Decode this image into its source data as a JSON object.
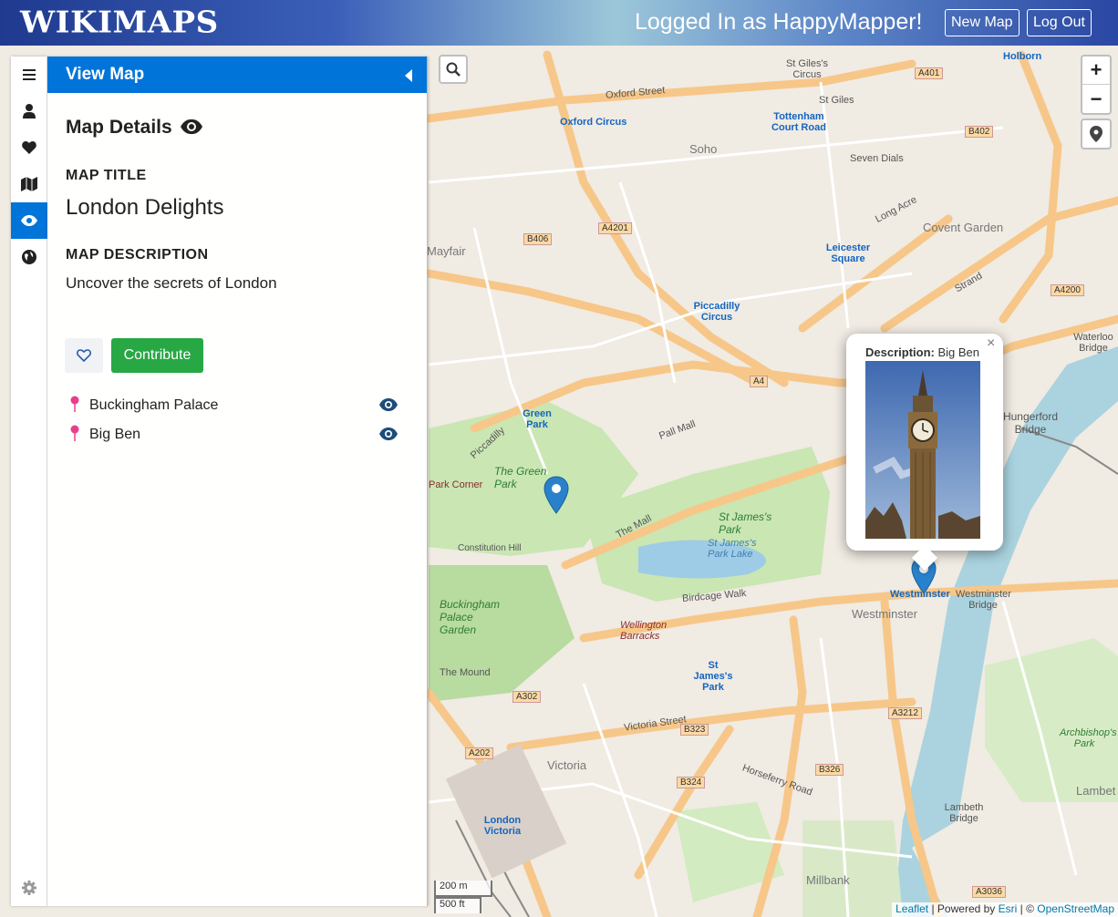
{
  "header": {
    "logo": "WikiMaps",
    "logged_in": "Logged In as HappyMapper!",
    "new_map": "New Map",
    "log_out": "Log Out"
  },
  "rail": {
    "items": [
      {
        "icon": "bars-icon"
      },
      {
        "icon": "user-icon"
      },
      {
        "icon": "heart-icon"
      },
      {
        "icon": "map-icon"
      },
      {
        "icon": "eye-icon",
        "active": true
      },
      {
        "icon": "globe-icon"
      }
    ],
    "settings_icon": "gear-icon"
  },
  "panel": {
    "header": "View Map",
    "section_title": "Map Details",
    "map_title_label": "MAP TITLE",
    "map_title": "London Delights",
    "map_description_label": "MAP DESCRIPTION",
    "map_description": "Uncover the secrets of London",
    "contribute": "Contribute",
    "places": [
      {
        "name": "Buckingham Palace"
      },
      {
        "name": "Big Ben"
      }
    ]
  },
  "popup": {
    "description_label": "Description:",
    "description": "Big Ben",
    "close": "×"
  },
  "map": {
    "zoom_in": "+",
    "zoom_out": "−",
    "scale_metric": "200 m",
    "scale_imperial": "500 ft",
    "attribution": {
      "leaflet": "Leaflet",
      "powered_by": " | Powered by ",
      "esri": "Esri",
      "sep": " | © ",
      "osm": "OpenStreetMap"
    },
    "labels": {
      "soho": "Soho",
      "mayfair": "Mayfair",
      "covent_garden": "Covent Garden",
      "oxford_circus": "Oxford Circus",
      "tottenham": "Tottenham Court Road",
      "leicester": "Leicester Square",
      "piccadilly_circus": "Piccadilly Circus",
      "green_park_station": "Green Park",
      "the_green_park": "The Green Park",
      "st_james_park": "St James's Park",
      "st_james_park_lake": "St James's Park Lake",
      "buckingham_garden": "Buckingham Palace Garden",
      "wellington": "Wellington Barracks",
      "victoria": "Victoria",
      "london_victoria": "London Victoria",
      "westminster": "Westminster",
      "westminster_station": "Westminster",
      "westminster_bridge": "Westminster Bridge",
      "millbank": "Millbank",
      "lambeth_bridge": "Lambeth Bridge",
      "hungerford": "Hungerford Bridge",
      "waterloo_bridge": "Waterloo Bridge",
      "the_mall": "The Mall",
      "pall_mall": "Pall Mall",
      "piccadilly": "Piccadilly",
      "oxford_street": "Oxford Street",
      "victoria_street": "Victoria Street",
      "birdcage_walk": "Birdcage Walk",
      "strand": "Strand",
      "st_giles": "St Giles",
      "st_giles_circus": "St Giles's Circus",
      "holborn": "Holborn",
      "seven_dials": "Seven Dials",
      "the_mound": "The Mound",
      "archbishops_park": "Archbishop's Park",
      "lambeth": "Lambet",
      "park_corner": "Park Corner",
      "constitution_hill": "Constitution Hill",
      "horseferry_road": "Horseferry Road",
      "long_acre": "Long Acre",
      "st_james_station": "St James's Park",
      "a401": "A401",
      "b402": "B402",
      "a4201": "A4201",
      "b406": "B406",
      "a4": "A4",
      "a4200": "A4200",
      "a302": "A302",
      "a202": "A202",
      "b323": "B323",
      "b324": "B324",
      "b326": "B326",
      "a3212": "A3212",
      "a3036": "A3036"
    }
  }
}
